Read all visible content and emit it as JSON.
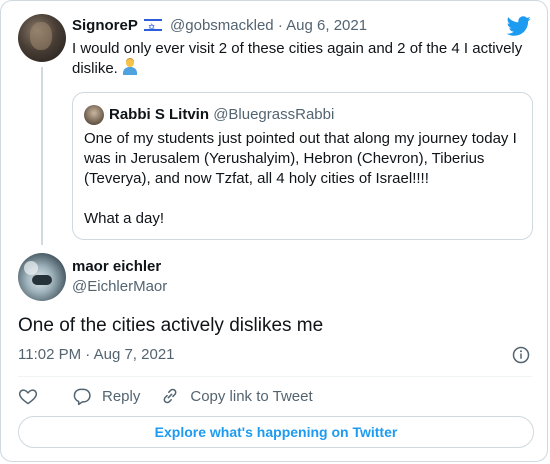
{
  "colors": {
    "accent": "#1d9bf0",
    "muted": "#536471",
    "border": "#cfd9de",
    "text": "#0f1419"
  },
  "parent_tweet": {
    "display_name": "SignoreP",
    "handle": "@gobsmackled",
    "date_separator": "·",
    "date": "Aug 6, 2021",
    "flag_icon": "israel-flag-icon",
    "text": "I would only ever visit 2 of these cities again and 2 of the 4 I actively dislike.",
    "emoji_icon": "person-shrugging-emoji"
  },
  "quoted_tweet": {
    "display_name": "Rabbi S Litvin",
    "handle": "@BluegrassRabbi",
    "text": "One of my students just pointed out that along my journey today I was in Jerusalem (Yerushalyim), Hebron (Chevron), Tiberius (Teverya), and now Tzfat, all 4 holy cities of Israel!!!!\n\nWhat a day!"
  },
  "main_tweet": {
    "display_name": "maor eichler",
    "handle": "@EichlerMaor",
    "text": "One of the cities actively dislikes me",
    "time": "11:02 PM",
    "separator": "·",
    "date": "Aug 7, 2021"
  },
  "actions": {
    "like_icon": "heart-icon",
    "reply_label": "Reply",
    "reply_icon": "reply-icon",
    "copy_label": "Copy link to Tweet",
    "copy_icon": "link-icon"
  },
  "explore_label": "Explore what's happening on Twitter"
}
